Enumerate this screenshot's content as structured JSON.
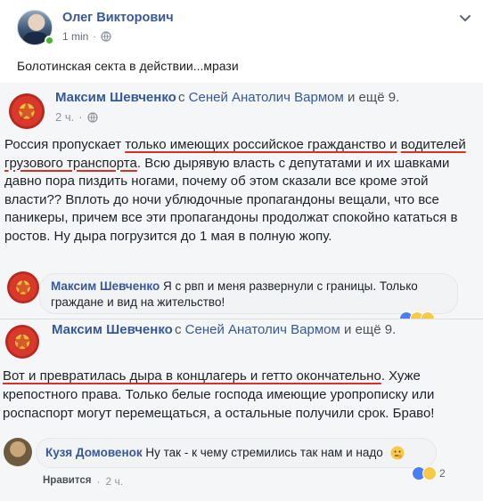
{
  "post": {
    "author": "Олег Викторович",
    "time": "1 min",
    "dot": "·",
    "text": "Болотинская секта в действии...мрази"
  },
  "shot1": {
    "author": "Максим Шевченко",
    "with_prefix": "с",
    "with_name": "Сеней Анатолич Вармом",
    "with_more": "и ещё 9.",
    "time": "2 ч.",
    "dot": "·",
    "body_start": "Россия пропускает ",
    "body_u1": "только имеющих российское гражданство и",
    "body_u2": "водителей грузового транспорта",
    "body_rest": ". Всю дырявую власть с депутатами и их шавками давно пора пиздить ногами, почему об этом сказали все кроме этой власти?? Вплоть до ночи ублюдочные пропагандоны вещали, что все паникеры, причем все эти пропагандоны продолжат спокойно кататься в ростов. Ну дыра погрузится до 1 мая в полную жопу.",
    "comment_author": "Максим Шевченко",
    "comment_text": "Я с рвп и меня развернули с границы. Только граждане и вид на жительство!"
  },
  "shot2": {
    "author": "Максим Шевченко",
    "with_prefix": "с",
    "with_name": "Сеней Анатолич Вармом",
    "with_more": "и ещё 9.",
    "body_u": "Вот и превратилась дыра в концлагерь и гетто окончательно",
    "body_rest": ". Хуже крепостного права. Только белые господа имеющие уропрописку или роспаспорт могут перемещаться, а остальные получили срок. Браво!",
    "comment_author": "Кузя Домовенок",
    "comment_text": "Ну так - к чему стремились так нам и надо",
    "reaction_count": "2",
    "like_label": "Нравится",
    "dot": "·",
    "comment_time": "2 ч."
  },
  "colors": {
    "link": "#385898",
    "underline": "#d93025",
    "online": "#42b72a"
  },
  "icons": {
    "globe": "globe-icon",
    "menu": "chevron-down-icon",
    "thinking": "thinking-emoji-icon"
  }
}
